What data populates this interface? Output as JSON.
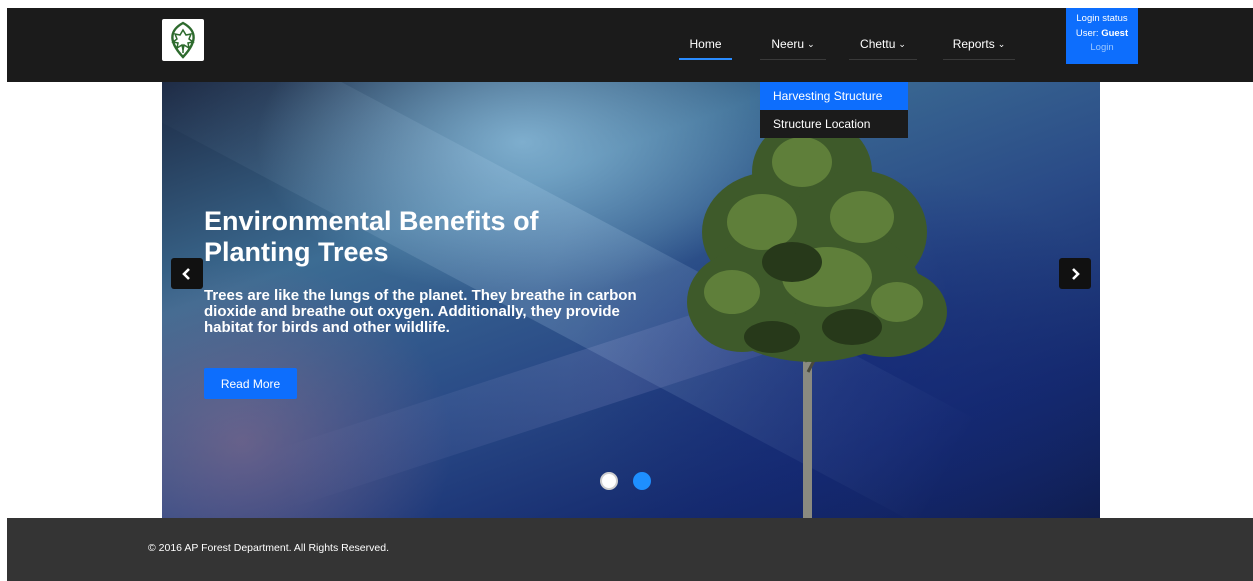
{
  "nav": {
    "items": [
      {
        "label": "Home",
        "dropdown": false,
        "active": true
      },
      {
        "label": "Neeru",
        "dropdown": true,
        "active": false
      },
      {
        "label": "Chettu",
        "dropdown": true,
        "active": false
      },
      {
        "label": "Reports",
        "dropdown": true,
        "active": false
      }
    ],
    "chevron": "⌄"
  },
  "login": {
    "status_label": "Login status",
    "user_prefix": "User:",
    "user_name": "Guest",
    "link_label": "Login"
  },
  "dropdown": {
    "items": [
      "Harvesting Structure",
      "Structure Location"
    ]
  },
  "hero": {
    "title": "Environmental Benefits of Planting Trees",
    "text": "Trees are like the lungs of the planet. They breathe in carbon dioxide and breathe out oxygen. Additionally, they provide habitat for birds and other wildlife.",
    "button_label": "Read More",
    "prev_icon": "‹",
    "next_icon": "›"
  },
  "footer": {
    "copyright": "© 2016 AP Forest Department. All Rights Reserved."
  },
  "colors": {
    "navbar": "#1b1b1b",
    "accent": "#0d6efd",
    "footer": "#343434"
  }
}
